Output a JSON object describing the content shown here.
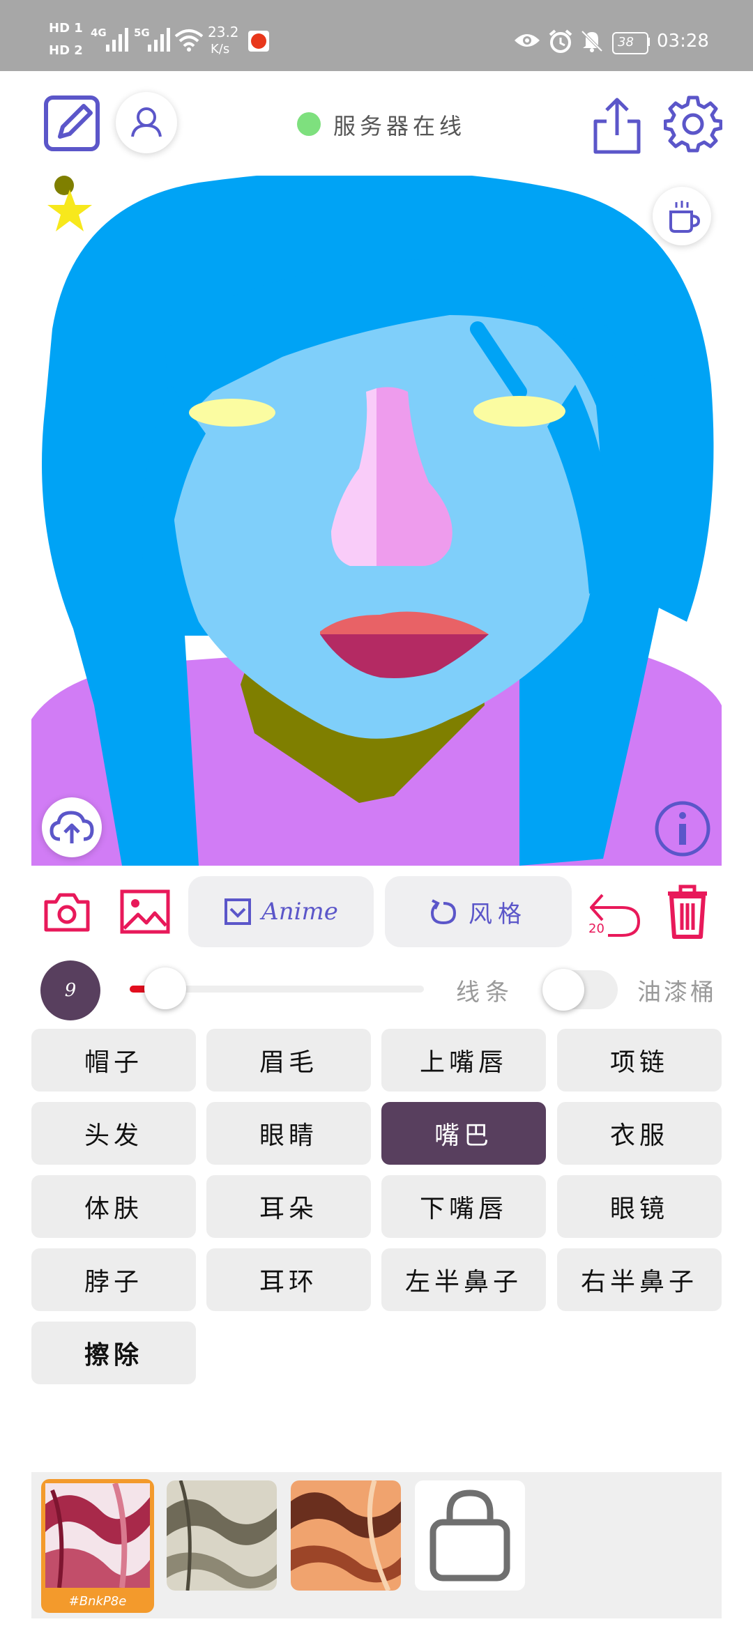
{
  "status_bar": {
    "hd1": "HD 1",
    "hd2": "HD 2",
    "net1": "4G",
    "net2": "5G",
    "speed_value": "23.2",
    "speed_unit": "K/s",
    "battery": "38",
    "time": "03:28"
  },
  "header": {
    "server_status": "服务器在线",
    "status_color": "#7ee07e"
  },
  "toolbar": {
    "anime_label": "Anime",
    "style_label": "风格",
    "undo_count": "20"
  },
  "brush": {
    "size": "9",
    "slider_fraction": 0.12,
    "line_label": "线条",
    "bucket_label": "油漆桶"
  },
  "parts": [
    {
      "label": "帽子",
      "selected": false
    },
    {
      "label": "眉毛",
      "selected": false
    },
    {
      "label": "上嘴唇",
      "selected": false
    },
    {
      "label": "项链",
      "selected": false
    },
    {
      "label": "头发",
      "selected": false
    },
    {
      "label": "眼睛",
      "selected": false
    },
    {
      "label": "嘴巴",
      "selected": true
    },
    {
      "label": "衣服",
      "selected": false
    },
    {
      "label": "体肤",
      "selected": false
    },
    {
      "label": "耳朵",
      "selected": false
    },
    {
      "label": "下嘴唇",
      "selected": false
    },
    {
      "label": "眼镜",
      "selected": false
    },
    {
      "label": "脖子",
      "selected": false
    },
    {
      "label": "耳环",
      "selected": false
    },
    {
      "label": "左半鼻子",
      "selected": false
    },
    {
      "label": "右半鼻子",
      "selected": false
    },
    {
      "label": "擦除",
      "selected": false
    }
  ],
  "styles": {
    "selected_tag": "#BnkP8e"
  },
  "colors": {
    "accent_purple": "#5b56c9",
    "accent_red": "#e8195a",
    "selected_part": "#583f5e",
    "hair": "#00a3f5",
    "skin": "#7fcffa",
    "clothes": "#d17cf5",
    "neck": "#7f7f00",
    "eyes": "#fbfca1",
    "nose_left": "#f9ccf9",
    "nose_right": "#ee9ced",
    "upper_lip": "#e86266",
    "lower_lip": "#b42a63"
  }
}
